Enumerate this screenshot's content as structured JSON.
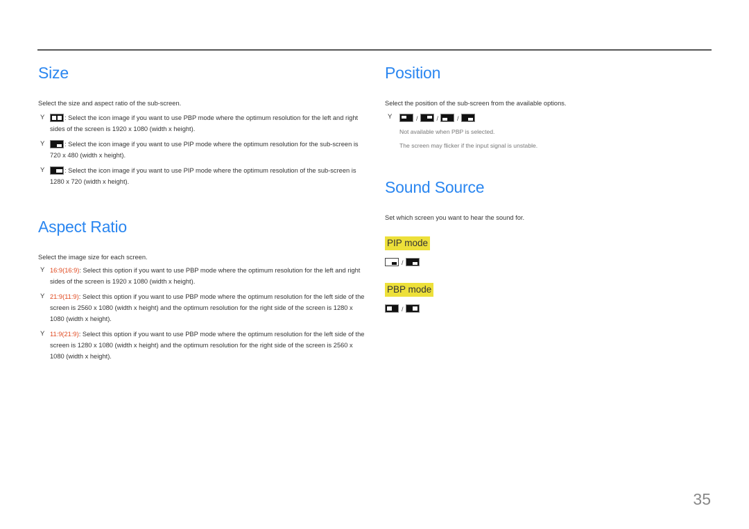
{
  "page": {
    "number": "35"
  },
  "size": {
    "title": "Size",
    "intro": "Select the size and aspect ratio of the sub-screen.",
    "bullet_marker": "Y",
    "items": [
      {
        "icon": "pbp-split-icon",
        "text": ": Select the icon image if you want to use PBP mode where the optimum resolution for the left and right sides of the screen is 1920 x 1080 (width x height)."
      },
      {
        "icon": "pip-small-icon",
        "text": ": Select the icon image if you want to use PIP mode where the optimum resolution for the sub-screen is 720 x 480 (width x height)."
      },
      {
        "icon": "pip-medium-icon",
        "text": ": Select the icon image if you want to use PIP mode where the optimum resolution of the sub-screen is 1280 x 720 (width x height)."
      }
    ]
  },
  "aspect_ratio": {
    "title": "Aspect Ratio",
    "intro": "Select the image size for each screen.",
    "items": [
      {
        "option": "16:9(16:9)",
        "text": ": Select this option if you want to use PBP mode where the optimum resolution for the left and right sides of the screen is 1920 x 1080 (width x height)."
      },
      {
        "option": "21:9(11:9)",
        "text": ": Select this option if you want to use PBP mode where the optimum resolution for the left side of the screen is 2560 x 1080 (width x height) and the optimum resolution for the right side of the screen is 1280 x 1080 (width x height)."
      },
      {
        "option": "11:9(21:9)",
        "text": ": Select this option if you want to use PBP mode where the optimum resolution for the left side of the screen is 1280 x 1080 (width x height) and the optimum resolution for the right side of the screen is 2560 x 1080 (width x height)."
      }
    ]
  },
  "position": {
    "title": "Position",
    "intro": "Select the position of the sub-screen from the available options.",
    "separator": "/",
    "icons": [
      "position-top-left-icon",
      "position-top-right-icon",
      "position-bottom-left-icon",
      "position-bottom-right-icon"
    ],
    "notes": [
      "Not available when PBP is selected.",
      "The screen may flicker if the input signal is unstable."
    ]
  },
  "sound_source": {
    "title": "Sound Source",
    "intro": "Set which screen you want to hear the sound for.",
    "separator": "/",
    "pip_mode_label": "PIP mode",
    "pbp_mode_label": "PBP mode",
    "pip_icons": [
      "sound-main-screen-icon",
      "sound-sub-screen-icon"
    ],
    "pbp_icons": [
      "sound-left-screen-icon",
      "sound-right-screen-icon"
    ]
  },
  "colors": {
    "heading": "#2a86f0",
    "option_label": "#e0481e",
    "mode_highlight": "#ede03a"
  }
}
